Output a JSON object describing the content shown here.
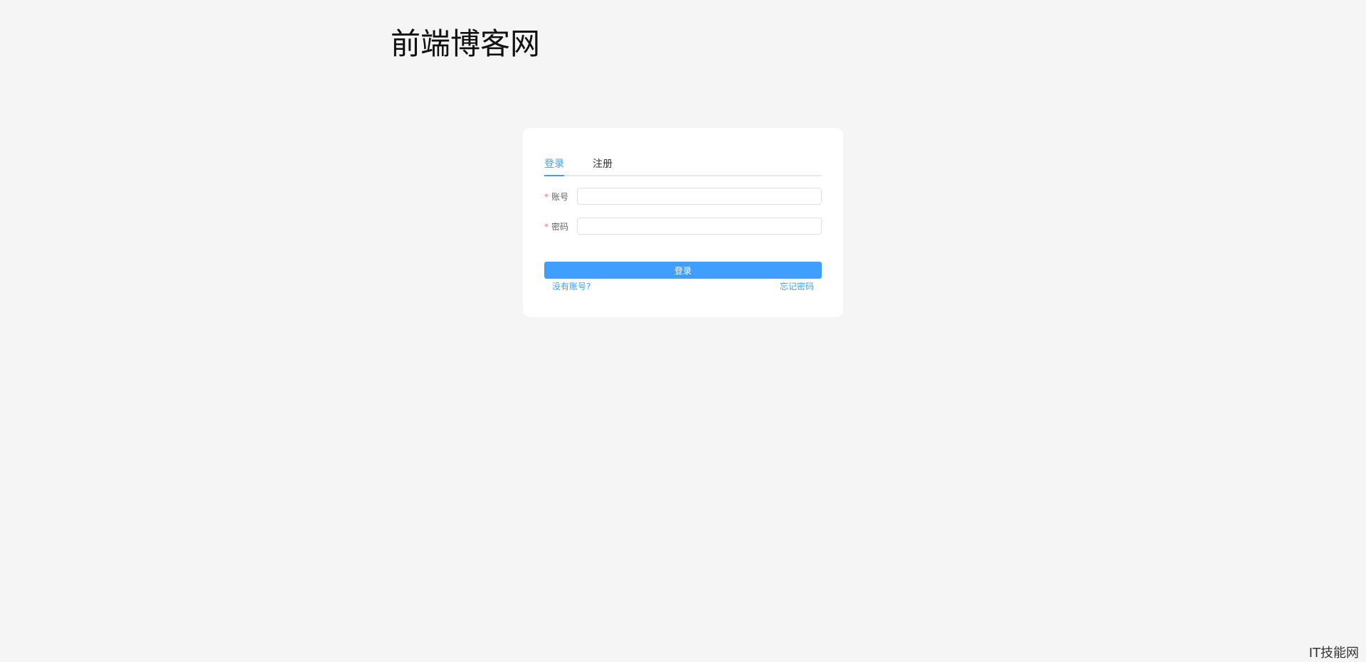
{
  "header": {
    "site_title": "前端博客网"
  },
  "login_card": {
    "tabs": [
      {
        "label": "登录",
        "active": true
      },
      {
        "label": "注册",
        "active": false
      }
    ],
    "account": {
      "required_mark": "*",
      "label": "账号",
      "value": "",
      "placeholder": ""
    },
    "password": {
      "required_mark": "*",
      "label": "密码",
      "value": "",
      "placeholder": ""
    },
    "submit_label": "登录",
    "no_account_link": "没有账号?",
    "forgot_password_link": "忘记密码"
  },
  "watermark": "IT技能网",
  "colors": {
    "accent": "#409eff",
    "background": "#f5f5f5",
    "required": "#f56c6c"
  }
}
